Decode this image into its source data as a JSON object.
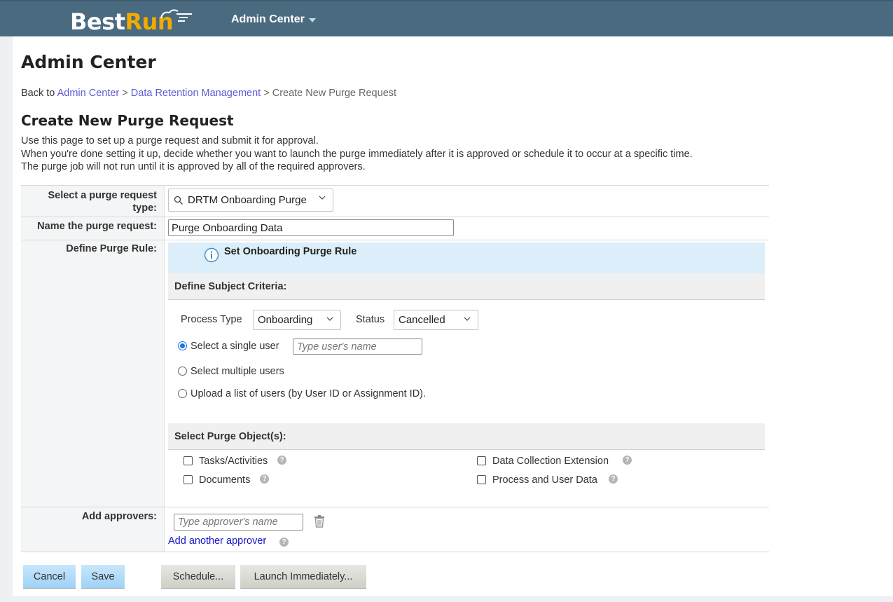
{
  "header": {
    "logo_best": "Best",
    "logo_run": "Run",
    "nav_title": "Admin Center"
  },
  "page": {
    "title": "Admin Center",
    "breadcrumb": {
      "prefix": "Back to",
      "link1": "Admin Center",
      "sep": ">",
      "link2": "Data Retention Management",
      "current": "Create New Purge Request"
    },
    "section_title": "Create New Purge Request",
    "intro": [
      "Use this page to set up a purge request and submit it for approval.",
      "When you're done setting it up, decide whether you want to launch the purge immediately after it is approved or schedule it to occur at a specific time.",
      "The purge job will not run until it is approved by all of the required approvers."
    ]
  },
  "form": {
    "type_label_line1": "Select a purge request",
    "type_label_line2": "type:",
    "type_value": "DRTM Onboarding Purge",
    "name_label": "Name the purge request:",
    "name_value": "Purge Onboarding Data",
    "rule_label": "Define Purge Rule:",
    "rule_header": "Set Onboarding Purge Rule",
    "subject_criteria": "Define Subject Criteria:",
    "process_type_label": "Process Type",
    "process_type_value": "Onboarding",
    "status_label": "Status",
    "status_value": "Cancelled",
    "radio_single": "Select a single user",
    "user_placeholder": "Type user's name",
    "radio_multiple": "Select multiple users",
    "radio_upload": "Upload a list of users (by User ID or Assignment ID).",
    "purge_objects": "Select Purge Object(s):",
    "obj_tasks": "Tasks/Activities",
    "obj_documents": "Documents",
    "obj_dce": "Data Collection Extension",
    "obj_process": "Process and User Data",
    "approvers_label": "Add approvers:",
    "approver_placeholder": "Type approver's name",
    "add_approver": "Add another approver"
  },
  "buttons": {
    "cancel": "Cancel",
    "save": "Save",
    "schedule": "Schedule...",
    "launch": "Launch Immediately..."
  },
  "colors": {
    "topbar": "#4a6a80",
    "link": "#5b5bd6",
    "rule_header_bg": "#dceef9",
    "primary_button": "#aad8f8"
  }
}
